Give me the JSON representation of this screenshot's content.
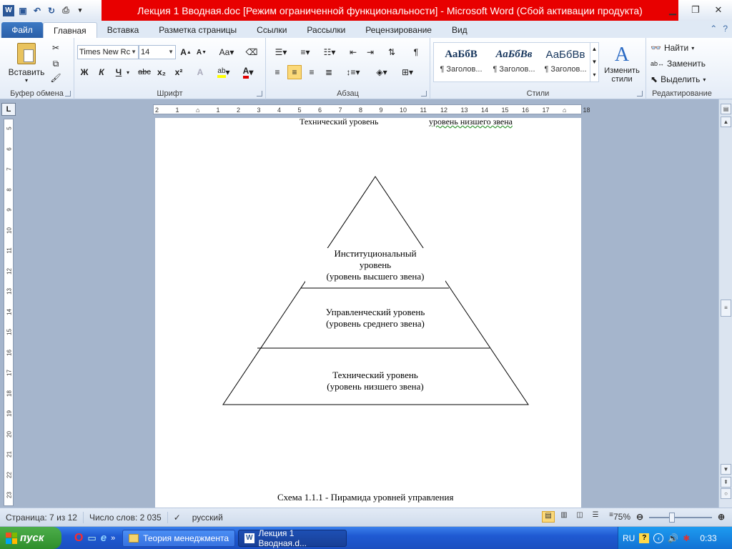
{
  "window": {
    "title": "Лекция 1 Вводная.doc [Режим ограниченной функциональности]  -  Microsoft Word (Сбой активации продукта)"
  },
  "qat": {
    "icons": [
      "word-icon",
      "save-icon",
      "undo-icon",
      "redo-icon",
      "print-preview-icon",
      "customize-icon"
    ]
  },
  "tabs": [
    {
      "label": "Файл"
    },
    {
      "label": "Главная"
    },
    {
      "label": "Вставка"
    },
    {
      "label": "Разметка страницы"
    },
    {
      "label": "Ссылки"
    },
    {
      "label": "Рассылки"
    },
    {
      "label": "Рецензирование"
    },
    {
      "label": "Вид"
    }
  ],
  "ribbon": {
    "clipboard": {
      "label": "Буфер обмена",
      "paste": "Вставить"
    },
    "font": {
      "label": "Шрифт",
      "font_name": "Times New Rc",
      "font_size": "14"
    },
    "paragraph": {
      "label": "Абзац"
    },
    "styles": {
      "label": "Стили",
      "items": [
        {
          "sample": "АаБбВ",
          "name": "¶ Заголов..."
        },
        {
          "sample": "АаБбВв",
          "name": "¶ Заголов..."
        },
        {
          "sample": "АаБбВв",
          "name": "¶ Заголов..."
        }
      ],
      "change_styles": "Изменить стили"
    },
    "editing": {
      "label": "Редактирование",
      "find": "Найти",
      "replace": "Заменить",
      "select": "Выделить"
    }
  },
  "document": {
    "top_line_left": "Технический  уровень",
    "top_line_right": "уровень низшего звена",
    "pyramid": {
      "top_line1": "Институциональный",
      "top_line2": "уровень",
      "top_line3": "(уровень высшего звена)",
      "mid_line1": "Управленческий уровень",
      "mid_line2": "(уровень среднего звена)",
      "bot_line1": "Технический уровень",
      "bot_line2": "(уровень низшего звена)"
    },
    "caption": "Схема 1.1.1 - Пирамида уровней управления"
  },
  "statusbar": {
    "page": "Страница: 7 из 12",
    "words": "Число слов: 2 035",
    "language": "русский",
    "zoom": "75%"
  },
  "taskbar": {
    "start": "пуск",
    "tasks": [
      {
        "label": "Теория менеджмента"
      },
      {
        "label": "Лекция 1 Вводная.d..."
      }
    ],
    "lang": "RU",
    "time": "0:33"
  }
}
